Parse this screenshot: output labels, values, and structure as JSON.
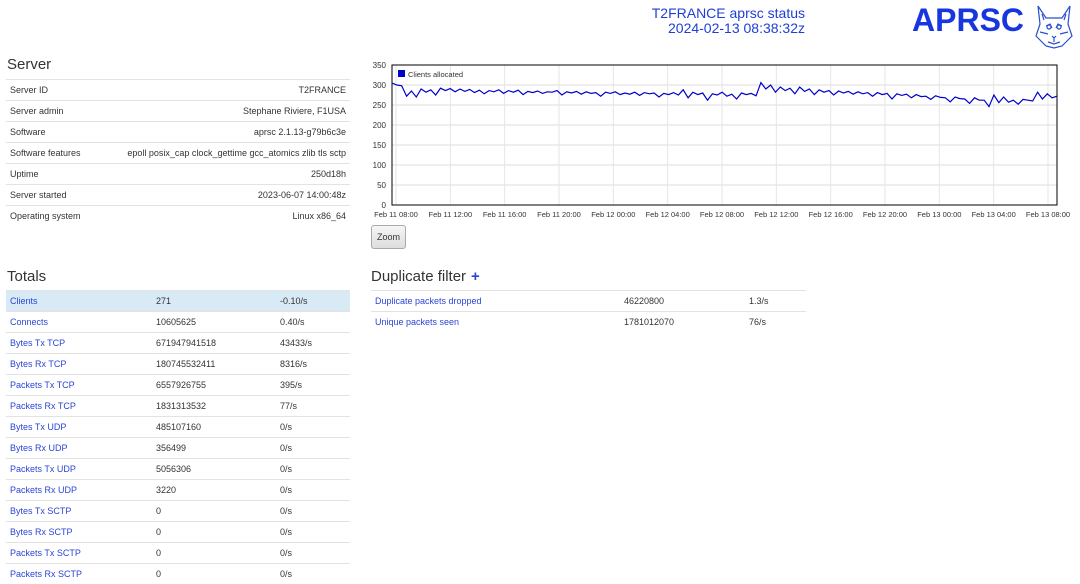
{
  "header": {
    "title": "T2FRANCE aprsc status",
    "timestamp": "2024-02-13 08:38:32z",
    "logo": "APRSC"
  },
  "server": {
    "heading": "Server",
    "rows": [
      {
        "label": "Server ID",
        "value": "T2FRANCE"
      },
      {
        "label": "Server admin",
        "value": "Stephane Riviere, F1USA"
      },
      {
        "label": "Software",
        "value": "aprsc 2.1.13-g79b6c3e"
      },
      {
        "label": "Software features",
        "value": "epoll posix_cap clock_gettime gcc_atomics zlib tls sctp"
      },
      {
        "label": "Uptime",
        "value": "250d18h"
      },
      {
        "label": "Server started",
        "value": "2023-06-07 14:00:48z"
      },
      {
        "label": "Operating system",
        "value": "Linux x86_64"
      }
    ]
  },
  "chart": {
    "zoom_label": "Zoom",
    "legend_color": "#0000cc"
  },
  "chart_data": {
    "type": "line",
    "series": [
      {
        "name": "Clients allocated",
        "values": [
          305,
          300,
          298,
          272,
          285,
          270,
          290,
          282,
          288,
          275,
          292,
          286,
          291,
          283,
          290,
          284,
          289,
          281,
          287,
          278,
          286,
          283,
          288,
          279,
          286,
          282,
          287,
          276,
          284,
          281,
          285,
          279,
          283,
          282,
          286,
          275,
          283,
          280,
          284,
          277,
          283,
          279,
          281,
          272,
          282,
          279,
          283,
          276,
          280,
          277,
          282,
          274,
          281,
          278,
          280,
          270,
          279,
          276,
          281,
          275,
          288,
          268,
          282,
          276,
          280,
          262,
          278,
          275,
          282,
          272,
          277,
          265,
          280,
          276,
          279,
          273,
          306,
          290,
          300,
          282,
          295,
          286,
          292,
          278,
          295,
          284,
          290,
          276,
          288,
          282,
          286,
          275,
          285,
          280,
          284,
          277,
          283,
          278,
          281,
          272,
          281,
          276,
          279,
          265,
          278,
          274,
          277,
          268,
          276,
          271,
          272,
          264,
          273,
          269,
          268,
          258,
          270,
          266,
          265,
          254,
          268,
          262,
          262,
          246,
          275,
          256,
          270,
          257,
          262,
          252,
          264,
          262,
          260,
          282,
          265,
          278,
          268,
          272
        ]
      }
    ],
    "x_start": "2024-02-11 06:00",
    "x_end": "2024-02-13 08:38",
    "x_tick_labels": [
      "Feb 11 08:00",
      "Feb 11 12:00",
      "Feb 11 16:00",
      "Feb 11 20:00",
      "Feb 12 00:00",
      "Feb 12 04:00",
      "Feb 12 08:00",
      "Feb 12 12:00",
      "Feb 12 16:00",
      "Feb 12 20:00",
      "Feb 13 00:00",
      "Feb 13 04:00",
      "Feb 13 08:00"
    ],
    "y_ticks": [
      0,
      50,
      100,
      150,
      200,
      250,
      300,
      350
    ],
    "ylim": [
      0,
      350
    ],
    "grid": true,
    "legend": "top-left"
  },
  "totals": {
    "heading": "Totals",
    "rows": [
      {
        "label": "Clients",
        "value": "271",
        "rate": "-0.10/s",
        "highlight": true
      },
      {
        "label": "Connects",
        "value": "10605625",
        "rate": "0.40/s"
      },
      {
        "label": "Bytes Tx TCP",
        "value": "671947941518",
        "rate": "43433/s"
      },
      {
        "label": "Bytes Rx TCP",
        "value": "180745532411",
        "rate": "8316/s"
      },
      {
        "label": "Packets Tx TCP",
        "value": "6557926755",
        "rate": "395/s"
      },
      {
        "label": "Packets Rx TCP",
        "value": "1831313532",
        "rate": "77/s"
      },
      {
        "label": "Bytes Tx UDP",
        "value": "485107160",
        "rate": "0/s"
      },
      {
        "label": "Bytes Rx UDP",
        "value": "356499",
        "rate": "0/s"
      },
      {
        "label": "Packets Tx UDP",
        "value": "5056306",
        "rate": "0/s"
      },
      {
        "label": "Packets Rx UDP",
        "value": "3220",
        "rate": "0/s"
      },
      {
        "label": "Bytes Tx SCTP",
        "value": "0",
        "rate": "0/s"
      },
      {
        "label": "Bytes Rx SCTP",
        "value": "0",
        "rate": "0/s"
      },
      {
        "label": "Packets Tx SCTP",
        "value": "0",
        "rate": "0/s"
      },
      {
        "label": "Packets Rx SCTP",
        "value": "0",
        "rate": "0/s"
      }
    ]
  },
  "dupfilter": {
    "heading": "Duplicate filter",
    "plus": "+",
    "rows": [
      {
        "label": "Duplicate packets dropped",
        "value": "46220800",
        "rate": "1.3/s"
      },
      {
        "label": "Unique packets seen",
        "value": "1781012070",
        "rate": "76/s"
      }
    ]
  }
}
